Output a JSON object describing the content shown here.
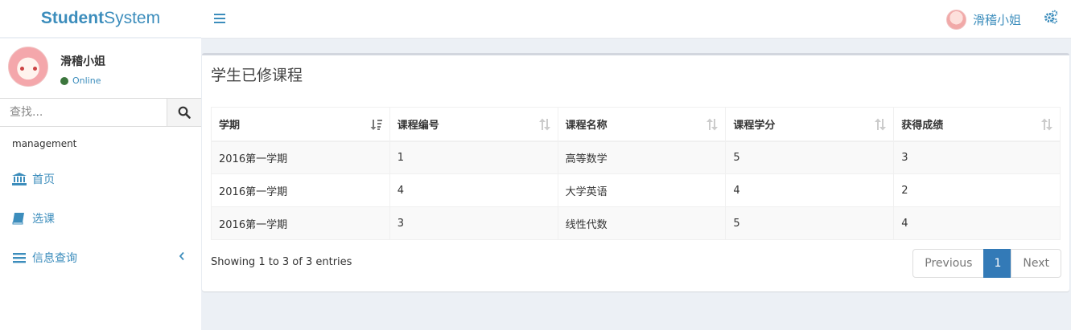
{
  "brand": {
    "bold": "Student",
    "rest": "System"
  },
  "navbar": {
    "user_name": "滑稽小姐"
  },
  "sidebar": {
    "user_name": "滑稽小姐",
    "status": "Online",
    "search_placeholder": "查找...",
    "section_label": "management",
    "items": [
      {
        "label": "首页",
        "icon": "bank-icon"
      },
      {
        "label": "选课",
        "icon": "book-icon"
      },
      {
        "label": "信息查询",
        "icon": "list-icon"
      }
    ]
  },
  "main": {
    "title": "学生已修课程",
    "columns": [
      "学期",
      "课程编号",
      "课程名称",
      "课程学分",
      "获得成绩"
    ],
    "rows": [
      [
        "2016第一学期",
        "1",
        "高等数学",
        "5",
        "3"
      ],
      [
        "2016第一学期",
        "4",
        "大学英语",
        "4",
        "2"
      ],
      [
        "2016第一学期",
        "3",
        "线性代数",
        "5",
        "4"
      ]
    ],
    "info": "Showing 1 to 3 of 3 entries",
    "pagination": {
      "previous": "Previous",
      "current": "1",
      "next": "Next"
    }
  },
  "colors": {
    "accent": "#3c8dbc",
    "page_bg": "#ecf0f5",
    "active_page": "#337ab7",
    "online": "#3c763d"
  }
}
